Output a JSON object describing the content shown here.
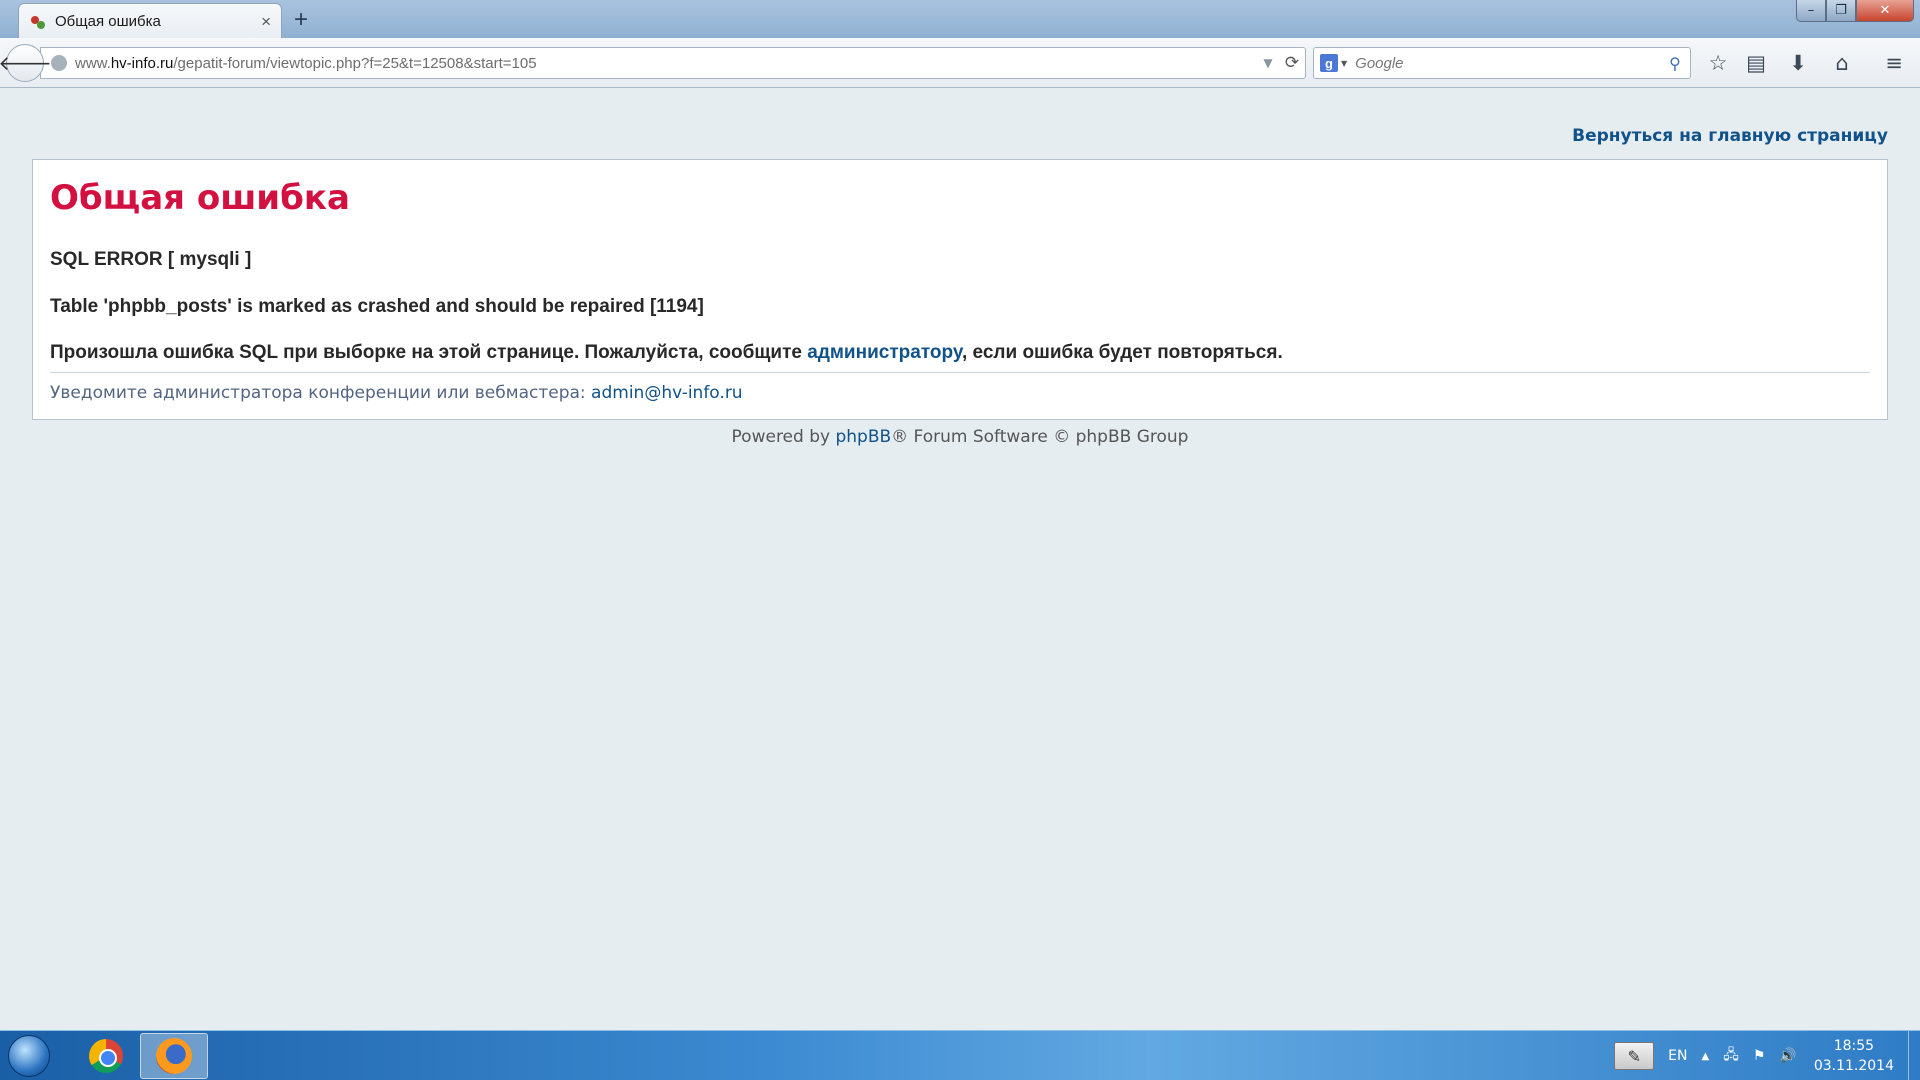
{
  "browser": {
    "tab_title": "Общая ошибка",
    "tab_close": "×",
    "new_tab": "+",
    "url_prefix": "www.",
    "url_domain": "hv-info.ru",
    "url_path": "/gepatit-forum/viewtopic.php?f=25&t=12508&start=105",
    "search_placeholder": "Google",
    "search_engine_letter": "g",
    "window_controls": {
      "minimize": "–",
      "maximize": "❐",
      "close": "✕"
    }
  },
  "page": {
    "return_link": "Вернуться на главную страницу",
    "title": "Общая ошибка",
    "sql_error": "SQL ERROR [ mysqli ]",
    "table_error": "Table 'phpbb_posts' is marked as crashed and should be repaired [1194]",
    "message_before": "Произошла ошибка SQL при выборке на этой странице. Пожалуйста, сообщите ",
    "message_link": "администратору",
    "message_after": ", если ошибка будет повторяться.",
    "notice_text": "Уведомите администратора конференции или вебмастера: ",
    "notice_email": "admin@hv-info.ru",
    "footer_before": "Powered by ",
    "footer_link": "phpBB",
    "footer_after": "® Forum Software © phpBB Group"
  },
  "taskbar": {
    "language": "EN",
    "tray_arrow": "▲",
    "time": "18:55",
    "date": "03.11.2014"
  },
  "colors": {
    "title_red": "#d31141",
    "link_blue": "#105289",
    "page_bg": "#e6edf1"
  }
}
